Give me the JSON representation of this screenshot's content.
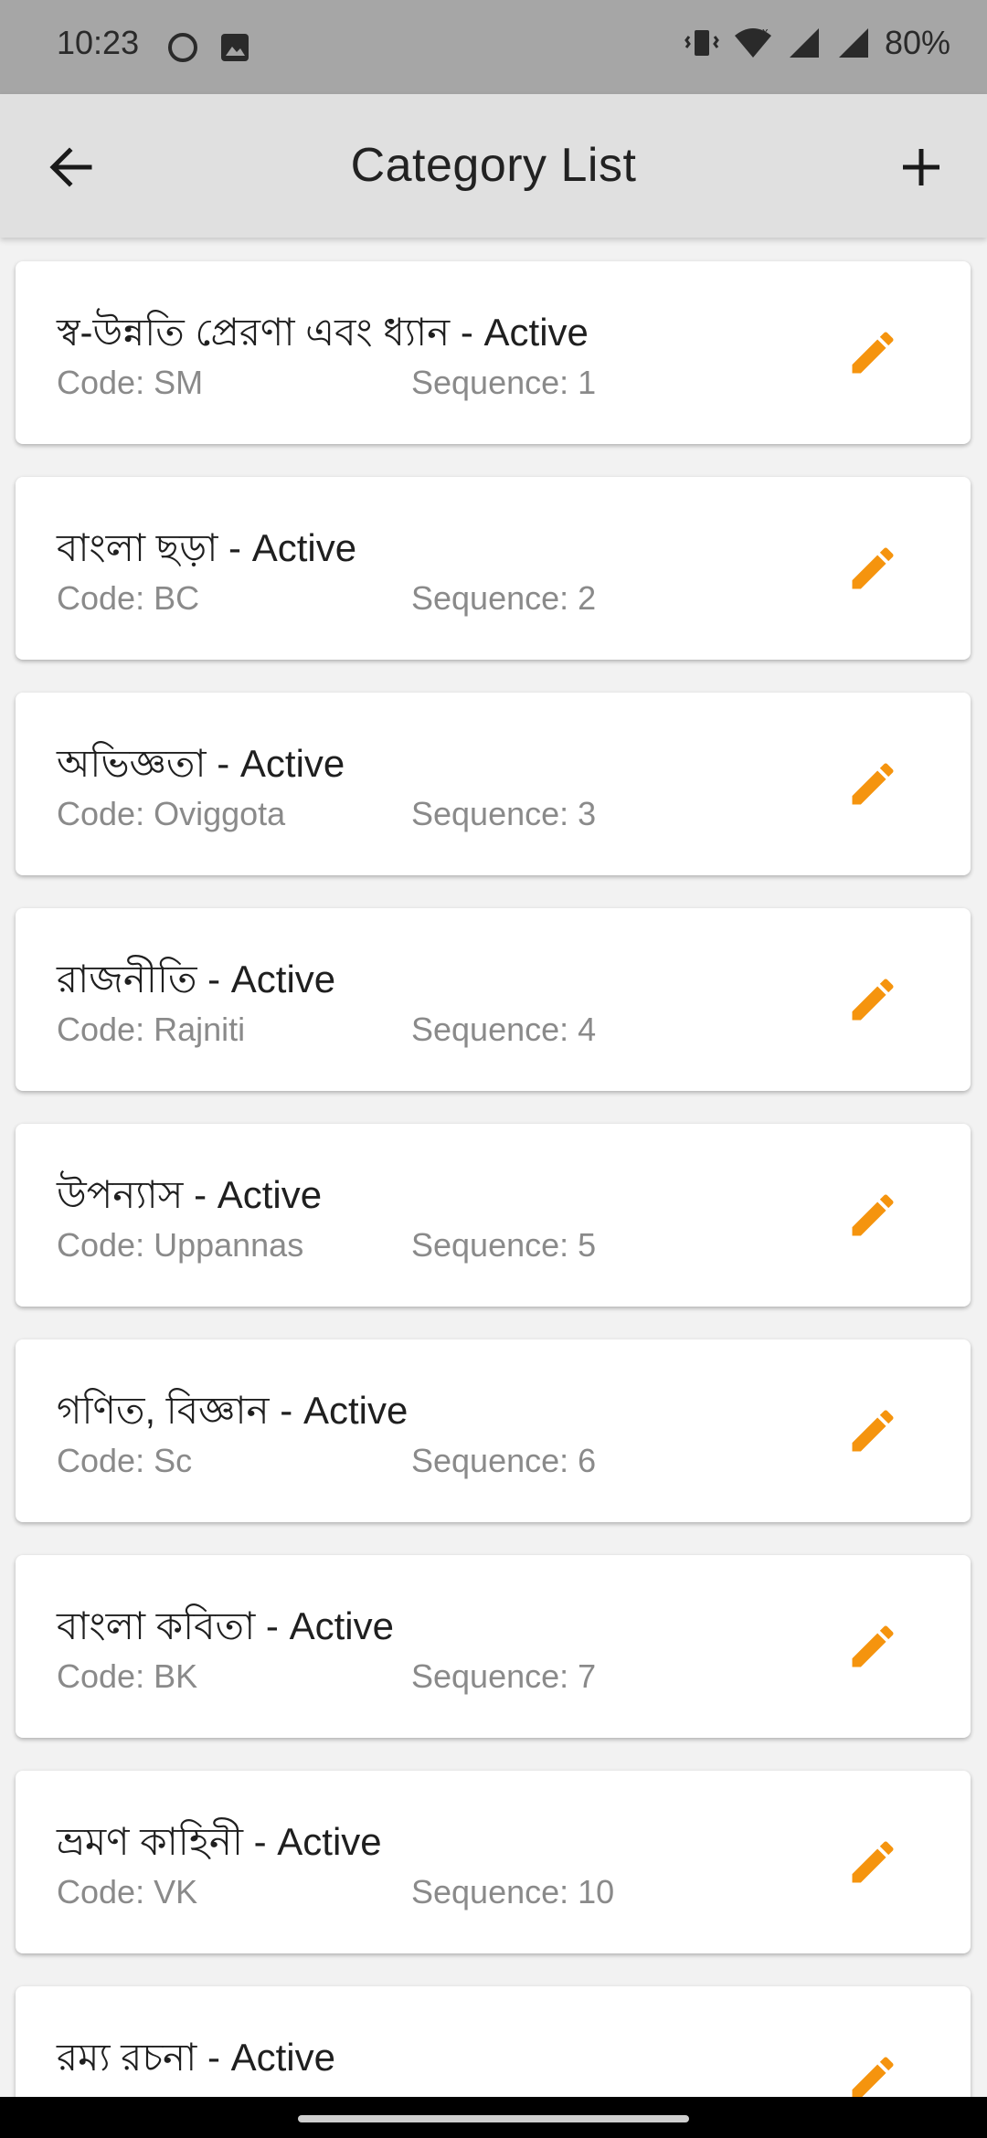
{
  "status_bar": {
    "time": "10:23",
    "battery": "80%"
  },
  "app_bar": {
    "title": "Category List",
    "back_icon": "arrow-left-icon",
    "add_icon": "plus-icon"
  },
  "colors": {
    "accent": "#F5940E",
    "app_bar_bg": "#E0E0E0",
    "status_bar_bg": "#A6A6A6"
  },
  "categories": [
    {
      "name": "স্ব-উন্নতি প্রেরণা এবং ধ্যান - Active",
      "code": "Code: SM",
      "sequence": "Sequence: 1"
    },
    {
      "name": "বাংলা ছড়া - Active",
      "code": "Code: BC",
      "sequence": "Sequence: 2"
    },
    {
      "name": "অভিজ্ঞতা - Active",
      "code": "Code: Oviggota",
      "sequence": "Sequence: 3"
    },
    {
      "name": "রাজনীতি - Active",
      "code": "Code: Rajniti",
      "sequence": "Sequence: 4"
    },
    {
      "name": "উপন্যাস - Active",
      "code": "Code: Uppannas",
      "sequence": "Sequence: 5"
    },
    {
      "name": "গণিত, বিজ্ঞান - Active",
      "code": "Code: Sc",
      "sequence": "Sequence: 6"
    },
    {
      "name": "বাংলা কবিতা - Active",
      "code": "Code: BK",
      "sequence": "Sequence: 7"
    },
    {
      "name": "ভ্রমণ কাহিনী - Active",
      "code": "Code: VK",
      "sequence": "Sequence: 10"
    },
    {
      "name": "রম্য রচনা - Active",
      "code": "",
      "sequence": ""
    }
  ]
}
